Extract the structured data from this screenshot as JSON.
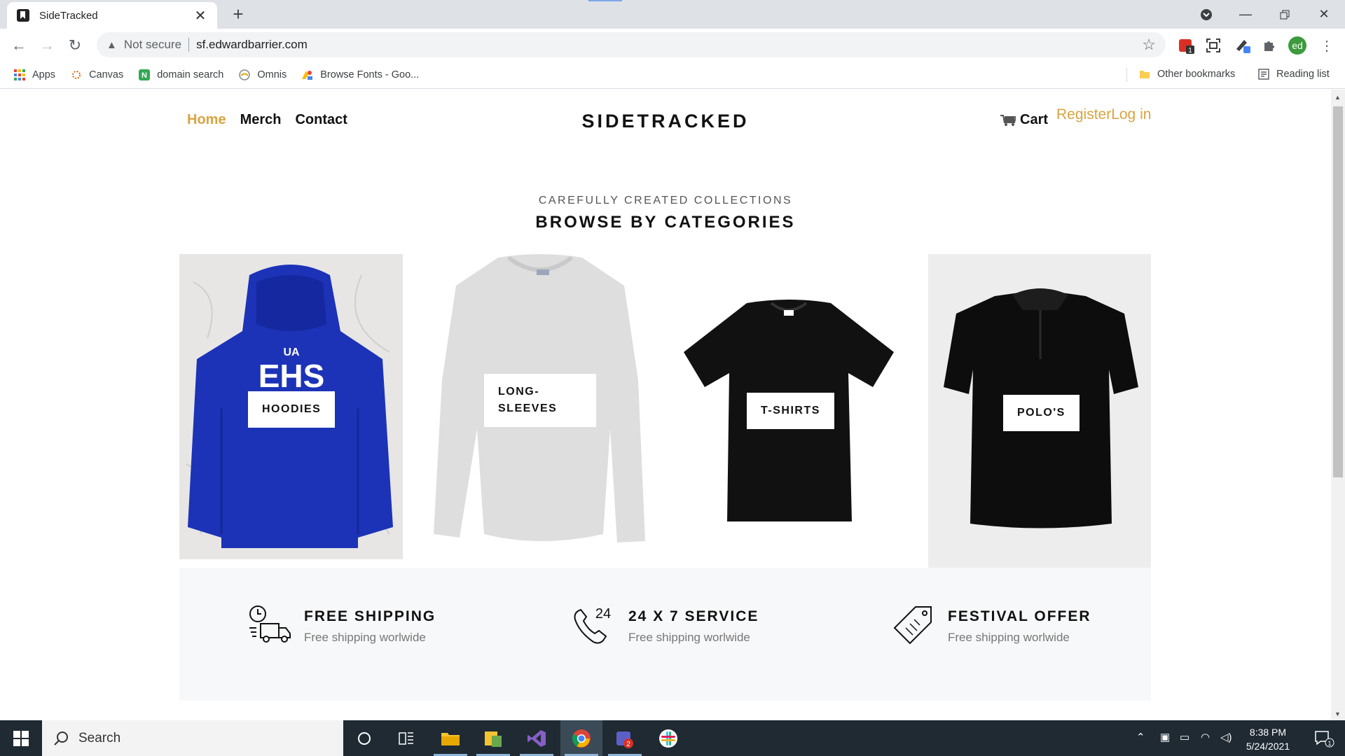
{
  "browser": {
    "tab_title": "SideTracked",
    "url_warning": "Not secure",
    "url": "sf.edwardbarrier.com",
    "bookmarks": [
      "Apps",
      "Canvas",
      "domain search",
      "Omnis",
      "Browse Fonts - Goo..."
    ],
    "other_bookmarks": "Other bookmarks",
    "reading_list": "Reading list",
    "profile_initials": "ed",
    "ext_badge": "1"
  },
  "site": {
    "nav": [
      "Home",
      "Merch",
      "Contact"
    ],
    "logo": "SIDETRACKED",
    "cart": "Cart",
    "auth": "RegisterLog in",
    "subtitle": "CAREFULLY CREATED COLLECTIONS",
    "heading": "BROWSE BY CATEGORIES",
    "categories": [
      {
        "label": "HOODIES"
      },
      {
        "label": "LONG-\nSLEEVES"
      },
      {
        "label": "T-SHIRTS"
      },
      {
        "label": "POLO'S"
      }
    ],
    "hoodie_print": "EHS",
    "features": [
      {
        "title": "FREE SHIPPING",
        "subtitle": "Free shipping worlwide"
      },
      {
        "title": "24 X 7 SERVICE",
        "subtitle": "Free shipping worlwide",
        "icon_text": "24"
      },
      {
        "title": "FESTIVAL OFFER",
        "subtitle": "Free shipping worlwide"
      }
    ],
    "accent": "#d9a441"
  },
  "taskbar": {
    "search": "Search",
    "time": "8:38 PM",
    "date": "5/24/2021",
    "teams_badge": "2",
    "notif_badge": "1"
  }
}
